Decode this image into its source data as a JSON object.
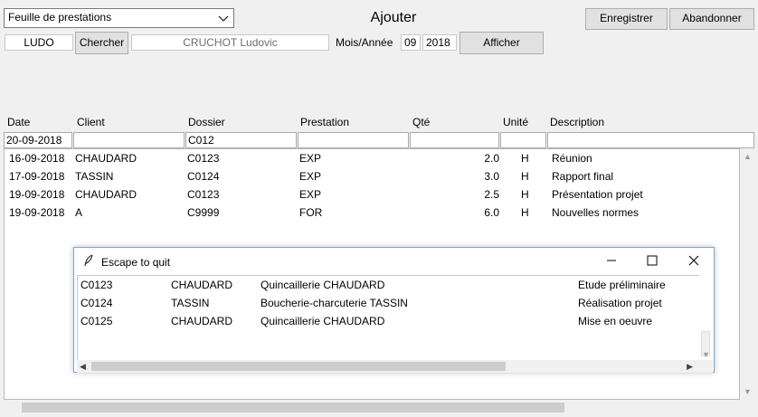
{
  "toolbar": {
    "mode_select_value": "Feuille de prestations",
    "page_title": "Ajouter",
    "save_label": "Enregistrer",
    "abandon_label": "Abandonner"
  },
  "search": {
    "user_code": "LUDO",
    "search_label": "Chercher",
    "user_name": "CRUCHOT Ludovic",
    "month_year_label": "Mois/Année",
    "month": "09",
    "year": "2018",
    "show_label": "Afficher"
  },
  "table": {
    "headers": [
      "Date",
      "Client",
      "Dossier",
      "Prestation",
      "Qté",
      "Unité",
      "Description"
    ],
    "filter": {
      "date": "20-09-2018",
      "client": "",
      "dossier": "C012",
      "prestation": "",
      "qte": "",
      "unite": "",
      "description": ""
    },
    "rows": [
      {
        "date": "16-09-2018",
        "client": "CHAUDARD",
        "dossier": "C0123",
        "prestation": "EXP",
        "qte": "2.0",
        "unite": "H",
        "description": "Réunion"
      },
      {
        "date": "17-09-2018",
        "client": "TASSIN",
        "dossier": "C0124",
        "prestation": "EXP",
        "qte": "3.0",
        "unite": "H",
        "description": "Rapport final"
      },
      {
        "date": "19-09-2018",
        "client": "CHAUDARD",
        "dossier": "C0123",
        "prestation": "EXP",
        "qte": "2.5",
        "unite": "H",
        "description": "Présentation projet"
      },
      {
        "date": "19-09-2018",
        "client": "A",
        "dossier": "C9999",
        "prestation": "FOR",
        "qte": "6.0",
        "unite": "H",
        "description": "Nouvelles normes"
      }
    ]
  },
  "popup": {
    "title": "Escape to quit",
    "rows": [
      {
        "dossier": "C0123",
        "client": "CHAUDARD",
        "name": "Quincaillerie CHAUDARD",
        "desc": "Etude préliminaire"
      },
      {
        "dossier": "C0124",
        "client": "TASSIN",
        "name": "Boucherie-charcuterie TASSIN",
        "desc": "Réalisation projet"
      },
      {
        "dossier": "C0125",
        "client": "CHAUDARD",
        "name": "Quincaillerie CHAUDARD",
        "desc": "Mise en oeuvre"
      }
    ]
  }
}
